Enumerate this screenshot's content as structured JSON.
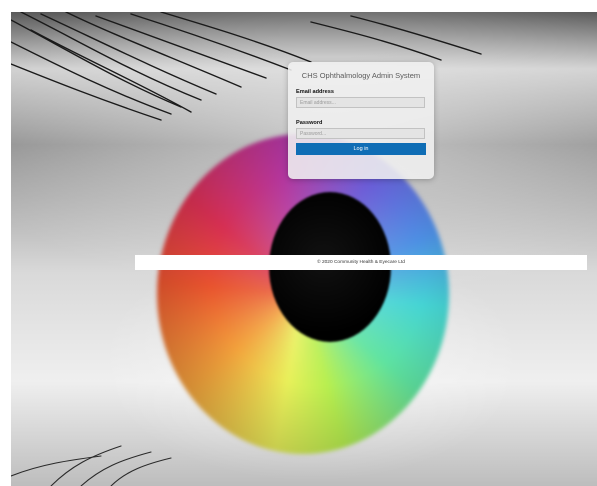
{
  "login": {
    "title": "CHS Ophthalmology Admin System",
    "email_label": "Email address",
    "email_placeholder": "Email address...",
    "email_value": "",
    "password_label": "Password",
    "password_placeholder": "Password...",
    "password_value": "",
    "submit_label": "Log in"
  },
  "footer": {
    "copyright": "© 2020 Community Health & Eyecare Ltd"
  },
  "colors": {
    "button_bg": "#0f6db5",
    "button_text": "#ffffff",
    "card_bg": "#f0f0f0"
  },
  "background": {
    "image_icon": "colorful-eye-photo"
  }
}
